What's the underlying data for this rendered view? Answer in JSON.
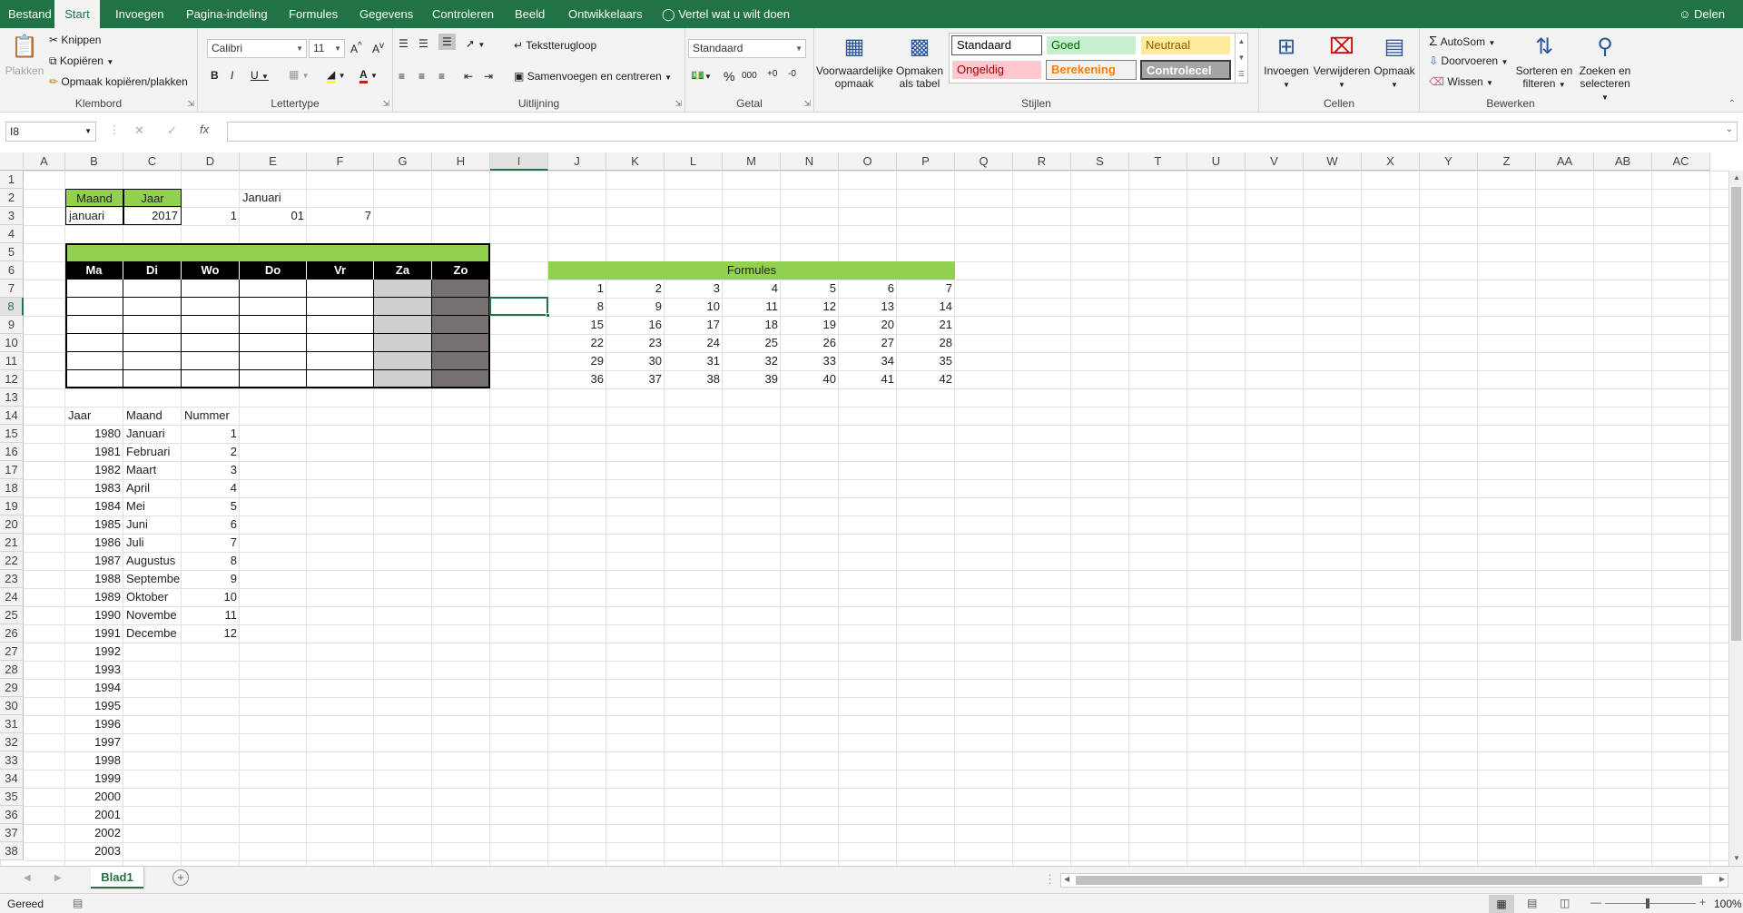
{
  "menu": {
    "tabs": [
      "Bestand",
      "Start",
      "Invoegen",
      "Pagina-indeling",
      "Formules",
      "Gegevens",
      "Controleren",
      "Beeld",
      "Ontwikkelaars"
    ],
    "tell_me": "Vertel wat u wilt doen",
    "share": "Delen"
  },
  "ribbon": {
    "clipboard": {
      "label": "Klembord",
      "paste": "Plakken",
      "cut": "Knippen",
      "copy": "Kopiëren",
      "format_painter": "Opmaak kopiëren/plakken"
    },
    "font": {
      "label": "Lettertype",
      "name": "Calibri",
      "size": "11"
    },
    "alignment": {
      "label": "Uitlijning",
      "wrap": "Tekstterugloop",
      "merge": "Samenvoegen en centreren"
    },
    "number": {
      "label": "Getal",
      "format": "Standaard"
    },
    "styles": {
      "label": "Stijlen",
      "conditional": "Voorwaardelijke opmaak",
      "table": "Opmaken als tabel",
      "cells": [
        {
          "name": "Standaard",
          "bg": "#ffffff",
          "fg": "#000000"
        },
        {
          "name": "Goed",
          "bg": "#c6efce",
          "fg": "#006100"
        },
        {
          "name": "Neutraal",
          "bg": "#ffeb9c",
          "fg": "#9c5700"
        },
        {
          "name": "Ongeldig",
          "bg": "#ffc7ce",
          "fg": "#9c0006"
        },
        {
          "name": "Berekening",
          "bg": "#f2f2f2",
          "fg": "#fa7d00"
        },
        {
          "name": "Controlecel",
          "bg": "#a5a5a5",
          "fg": "#ffffff"
        }
      ]
    },
    "cells": {
      "label": "Cellen",
      "insert": "Invoegen",
      "delete": "Verwijderen",
      "format": "Opmaak"
    },
    "editing": {
      "label": "Bewerken",
      "autosum": "AutoSom",
      "fill": "Doorvoeren",
      "clear": "Wissen",
      "sort": "Sorteren en filteren",
      "find": "Zoeken en selecteren"
    }
  },
  "formula_bar": {
    "name_box": "I8",
    "formula": ""
  },
  "sheet": {
    "columns": [
      "A",
      "B",
      "C",
      "D",
      "E",
      "F",
      "G",
      "H",
      "I",
      "J",
      "K",
      "L",
      "M",
      "N",
      "O",
      "P",
      "Q",
      "R",
      "S",
      "T",
      "U",
      "V",
      "W",
      "X",
      "Y",
      "Z",
      "AA",
      "AB",
      "AC"
    ],
    "rows": [
      "1",
      "2",
      "3",
      "4",
      "5",
      "6",
      "7",
      "8",
      "9",
      "10",
      "11",
      "12",
      "13",
      "14",
      "15",
      "16",
      "17",
      "18",
      "19",
      "20",
      "21",
      "22",
      "23",
      "24",
      "25",
      "26",
      "27",
      "28",
      "29",
      "30",
      "31",
      "32",
      "33",
      "34",
      "35",
      "36",
      "37",
      "38"
    ],
    "month_label": "Maand",
    "year_label": "Jaar",
    "month_value": "januari",
    "year_value": "2017",
    "d3": "1",
    "e3": "01",
    "f3": "7",
    "e2": "Januari",
    "weekdays": [
      "Ma",
      "Di",
      "Wo",
      "Do",
      "Vr",
      "Za",
      "Zo"
    ],
    "formules_title": "Formules",
    "formules": [
      [
        "1",
        "2",
        "3",
        "4",
        "5",
        "6",
        "7"
      ],
      [
        "8",
        "9",
        "10",
        "11",
        "12",
        "13",
        "14"
      ],
      [
        "15",
        "16",
        "17",
        "18",
        "19",
        "20",
        "21"
      ],
      [
        "22",
        "23",
        "24",
        "25",
        "26",
        "27",
        "28"
      ],
      [
        "29",
        "30",
        "31",
        "32",
        "33",
        "34",
        "35"
      ],
      [
        "36",
        "37",
        "38",
        "39",
        "40",
        "41",
        "42"
      ]
    ],
    "list_headers": [
      "Jaar",
      "Maand",
      "Nummer"
    ],
    "years": [
      "1980",
      "1981",
      "1982",
      "1983",
      "1984",
      "1985",
      "1986",
      "1987",
      "1988",
      "1989",
      "1990",
      "1991",
      "1992",
      "1993",
      "1994",
      "1995",
      "1996",
      "1997",
      "1998",
      "1999",
      "2000",
      "2001",
      "2002",
      "2003"
    ],
    "months": [
      "Januari",
      "Februari",
      "Maart",
      "April",
      "Mei",
      "Juni",
      "Juli",
      "Augustus",
      "Septembe",
      "Oktober",
      "Novembe",
      "Decembe"
    ],
    "numbers": [
      "1",
      "2",
      "3",
      "4",
      "5",
      "6",
      "7",
      "8",
      "9",
      "10",
      "11",
      "12"
    ]
  },
  "sheet_tab": "Blad1",
  "status": {
    "ready": "Gereed",
    "zoom": "100%"
  },
  "colors": {
    "green_header": "#92d050",
    "excel_green": "#217346",
    "weekend_light": "#d0cece",
    "weekend_dark": "#767171"
  }
}
